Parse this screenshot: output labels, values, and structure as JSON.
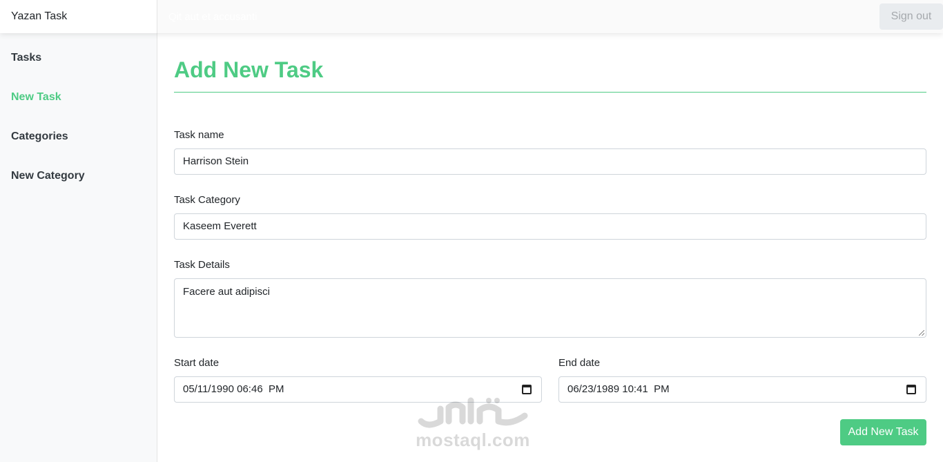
{
  "app": {
    "brand": "Yazan Task",
    "search_placeholder": "Qit aut et accusanti",
    "sign_out_label": "Sign out"
  },
  "sidebar": {
    "items": [
      {
        "label": "Tasks",
        "active": false
      },
      {
        "label": "New Task",
        "active": true
      },
      {
        "label": "Categories",
        "active": false
      },
      {
        "label": "New Category",
        "active": false
      }
    ]
  },
  "form": {
    "title": "Add New Task",
    "task_name": {
      "label": "Task name",
      "value": "Harrison Stein"
    },
    "task_category": {
      "label": "Task Category",
      "value": "Kaseem Everett"
    },
    "task_details": {
      "label": "Task Details",
      "value": "Facere aut adipisci"
    },
    "start_date": {
      "label": "Start date",
      "value": "05/11/1990 06:46  PM",
      "icon": "calendar-icon"
    },
    "end_date": {
      "label": "End date",
      "value": "06/23/1989 10:41  PM",
      "icon": "calendar-icon"
    },
    "submit_label": "Add New Task"
  },
  "watermark": {
    "text": "mostaql.com"
  },
  "colors": {
    "accent": "#4ecb84",
    "sidebar_bg": "#f8f9fa",
    "topbar_bg": "#fafafa",
    "border": "#ced4da"
  }
}
